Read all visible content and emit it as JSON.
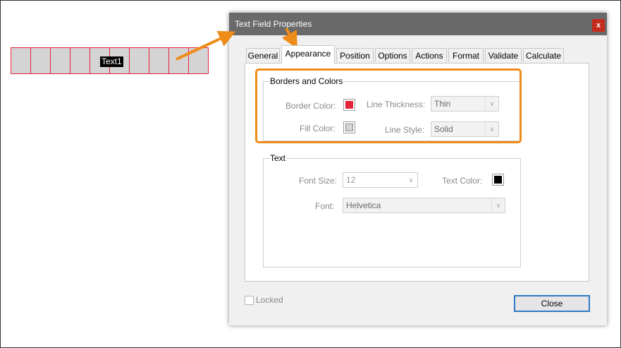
{
  "canvas": {
    "field_name_tag": "Text1",
    "comb_cells": 10
  },
  "dialog": {
    "title": "Text Field Properties",
    "close_glyph": "x",
    "tabs": [
      "General",
      "Appearance",
      "Position",
      "Options",
      "Actions",
      "Format",
      "Validate",
      "Calculate"
    ],
    "active_tab": "Appearance",
    "borders_group": {
      "title": "Borders and Colors",
      "border_color_label": "Border Color:",
      "border_color": "#e5243b",
      "fill_color_label": "Fill Color:",
      "fill_color": "#d4d4d4",
      "line_thickness_label": "Line Thickness:",
      "line_thickness_value": "Thin",
      "line_style_label": "Line Style:",
      "line_style_value": "Solid"
    },
    "text_group": {
      "title": "Text",
      "font_size_label": "Font Size:",
      "font_size_value": "12",
      "text_color_label": "Text Color:",
      "text_color": "#000000",
      "font_label": "Font:",
      "font_value": "Helvetica"
    },
    "locked_label": "Locked",
    "locked_checked": false,
    "close_button_label": "Close"
  },
  "annotation_color": "#ef8b19"
}
